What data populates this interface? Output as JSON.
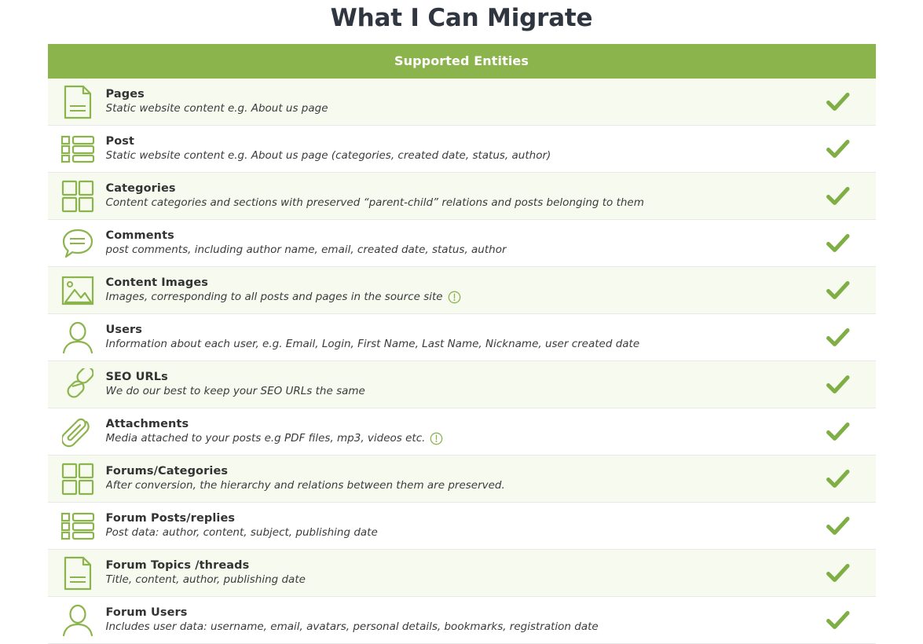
{
  "page": {
    "title": "What I Can Migrate"
  },
  "table": {
    "header": "Supported Entities",
    "accent_color": "#8cb44d",
    "row_tint_color": "#f6faef",
    "check_color": "#7fae44",
    "rows": [
      {
        "icon": "document-icon",
        "title": "Pages",
        "description": "Static website content e.g. About us page",
        "info": false,
        "supported": true
      },
      {
        "icon": "list-blocks-icon",
        "title": "Post",
        "description": "Static website content e.g. About us page (categories, created date, status, author)",
        "info": false,
        "supported": true
      },
      {
        "icon": "grid-squares-icon",
        "title": "Categories",
        "description": "Content categories and sections with preserved “parent-child” relations and posts belonging to them",
        "info": false,
        "supported": true
      },
      {
        "icon": "speech-bubble-icon",
        "title": "Comments",
        "description": "post comments, including author name, email, created date, status, author",
        "info": false,
        "supported": true
      },
      {
        "icon": "image-icon",
        "title": "Content Images",
        "description": "Images, corresponding to all posts and pages in the source site",
        "info": true,
        "supported": true
      },
      {
        "icon": "user-icon",
        "title": "Users",
        "description": "Information about each user, e.g. Email, Login, First Name, Last Name, Nickname, user created date",
        "info": false,
        "supported": true
      },
      {
        "icon": "chain-link-icon",
        "title": "SEO URLs",
        "description": "We do our best to keep your SEO URLs the same",
        "info": false,
        "supported": true
      },
      {
        "icon": "paperclip-icon",
        "title": "Attachments",
        "description": "Media attached to your posts e.g PDF files, mp3, videos etc.",
        "info": true,
        "supported": true
      },
      {
        "icon": "grid-squares-icon",
        "title": "Forums/Categories",
        "description": "After conversion, the hierarchy and relations between them are preserved.",
        "info": false,
        "supported": true
      },
      {
        "icon": "list-blocks-icon",
        "title": "Forum Posts/replies",
        "description": "Post data: author, content, subject, publishing date",
        "info": false,
        "supported": true
      },
      {
        "icon": "document-icon",
        "title": "Forum Topics /threads",
        "description": "Title, content, author, publishing date",
        "info": false,
        "supported": true
      },
      {
        "icon": "user-icon",
        "title": "Forum Users",
        "description": "Includes user data: username, email, avatars, personal details, bookmarks, registration date",
        "info": false,
        "supported": true
      }
    ]
  }
}
